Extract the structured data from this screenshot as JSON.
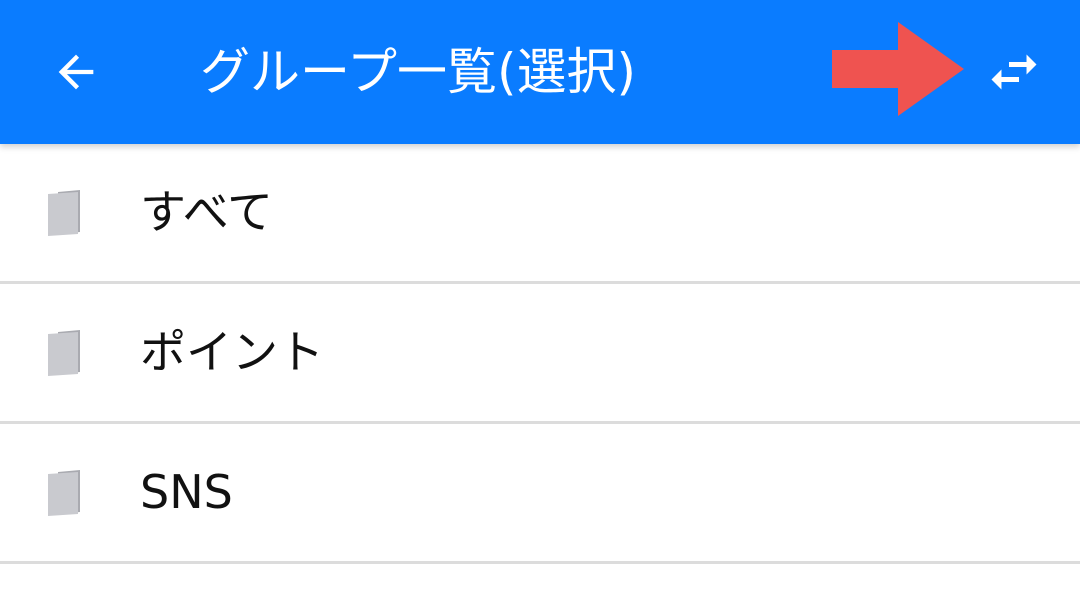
{
  "app_bar": {
    "title": "グループ一覧(選択)",
    "back_icon": "arrow-back-icon",
    "swap_icon": "swap-horizontal-icon",
    "background_color": "#0a7cff"
  },
  "annotation": {
    "icon": "red-arrow-pointer-icon",
    "color": "#ef5350"
  },
  "groups": {
    "icon": "folder-icon",
    "items": [
      {
        "label": "すべて"
      },
      {
        "label": "ポイント"
      },
      {
        "label": "SNS"
      }
    ]
  }
}
